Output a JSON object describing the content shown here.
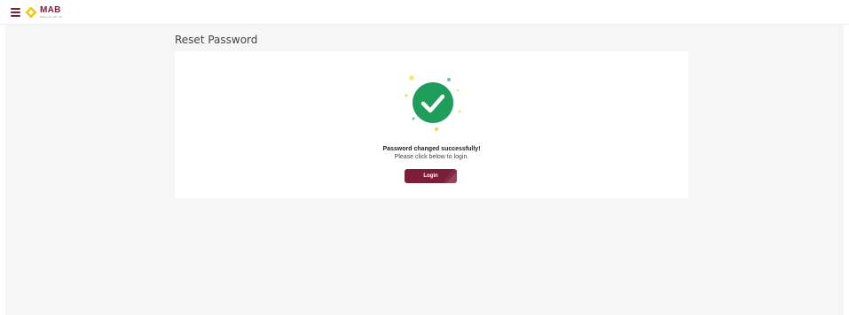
{
  "header": {
    "logo_text": "MAB",
    "logo_tagline": "Bank only with You"
  },
  "page": {
    "title": "Reset Password"
  },
  "card": {
    "message_title": "Password changed successfully!",
    "message_subtitle": "Please click below to login.",
    "login_label": "Login"
  },
  "colors": {
    "brand_maroon": "#7a1e3a",
    "logo_yellow": "#f2c200",
    "success_green": "#1f9e5b",
    "background": "#f6f6f6"
  }
}
